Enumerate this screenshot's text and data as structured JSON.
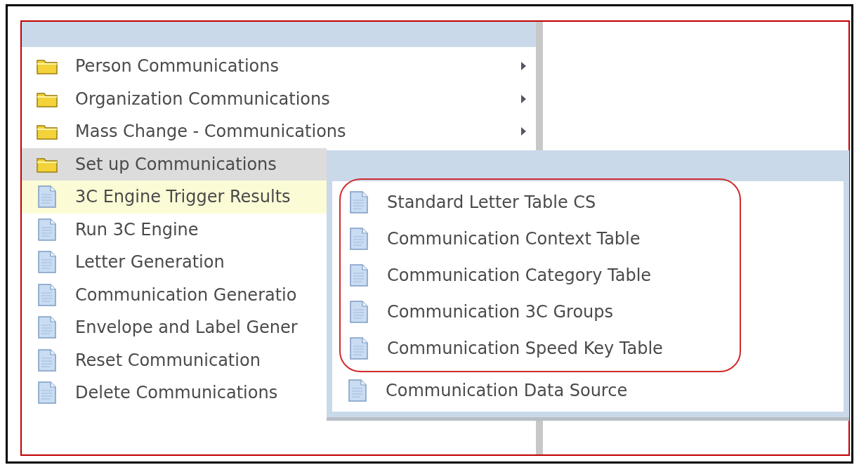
{
  "menu": {
    "items": [
      {
        "kind": "folder",
        "label": "Person Communications",
        "expanded": false
      },
      {
        "kind": "folder",
        "label": "Organization Communications",
        "expanded": false
      },
      {
        "kind": "folder",
        "label": "Mass Change - Communications",
        "expanded": false
      },
      {
        "kind": "folder",
        "label": "Set up Communications",
        "expanded": true
      },
      {
        "kind": "page",
        "label": "3C Engine Trigger Results",
        "selected": true
      },
      {
        "kind": "page",
        "label": "Run 3C Engine",
        "selected": false
      },
      {
        "kind": "page",
        "label": "Letter Generation",
        "selected": false
      },
      {
        "kind": "page",
        "label": "Communication Generatio",
        "selected": false
      },
      {
        "kind": "page",
        "label": "Envelope and Label Gener",
        "selected": false
      },
      {
        "kind": "page",
        "label": "Reset Communication",
        "selected": false
      },
      {
        "kind": "page",
        "label": "Delete Communications",
        "selected": false
      }
    ]
  },
  "submenu": {
    "items": [
      {
        "kind": "page",
        "label": "Standard Letter Table CS",
        "selected": false,
        "circled": true
      },
      {
        "kind": "page",
        "label": "Communication Context Table",
        "selected": false,
        "circled": true
      },
      {
        "kind": "page",
        "label": "Communication Category Table",
        "selected": false,
        "circled": true
      },
      {
        "kind": "page",
        "label": "Communication 3C Groups",
        "selected": false,
        "circled": true
      },
      {
        "kind": "page",
        "label": "Communication Speed Key Table",
        "selected": false,
        "circled": true
      },
      {
        "kind": "page",
        "label": "Communication Data Source",
        "selected": false,
        "circled": false
      }
    ]
  }
}
